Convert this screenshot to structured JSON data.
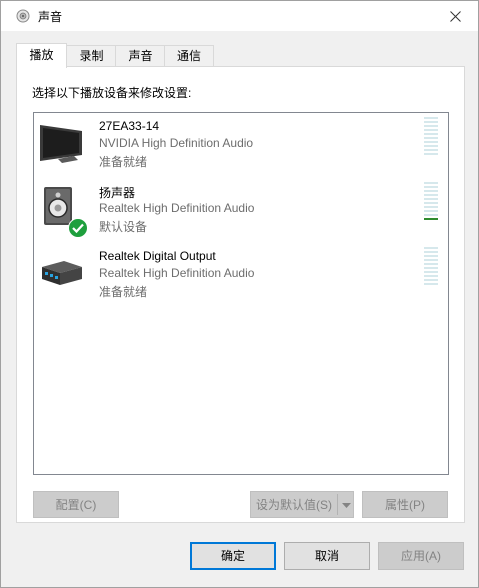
{
  "window": {
    "title": "声音",
    "close_glyph": "✕"
  },
  "tabs": [
    {
      "label": "播放",
      "active": true
    },
    {
      "label": "录制",
      "active": false
    },
    {
      "label": "声音",
      "active": false
    },
    {
      "label": "通信",
      "active": false
    }
  ],
  "playback": {
    "instruction": "选择以下播放设备来修改设置:",
    "devices": [
      {
        "name": "27EA33-14",
        "description": "NVIDIA High Definition Audio",
        "status": "准备就绪",
        "icon": "monitor-icon",
        "is_default": false,
        "level": 0
      },
      {
        "name": "扬声器",
        "description": "Realtek High Definition Audio",
        "status": "默认设备",
        "icon": "speaker-icon",
        "is_default": true,
        "level": 0.05
      },
      {
        "name": "Realtek Digital Output",
        "description": "Realtek High Definition Audio",
        "status": "准备就绪",
        "icon": "digital-output-icon",
        "is_default": false,
        "level": 0
      }
    ],
    "buttons": {
      "configure": "配置(C)",
      "set_default": "设为默认值(S)",
      "properties": "属性(P)"
    }
  },
  "footer": {
    "ok": "确定",
    "cancel": "取消",
    "apply": "应用(A)"
  },
  "colors": {
    "accent": "#0078d7",
    "default_check": "#1e9f3d",
    "meter_active": "#2e8b2e"
  }
}
